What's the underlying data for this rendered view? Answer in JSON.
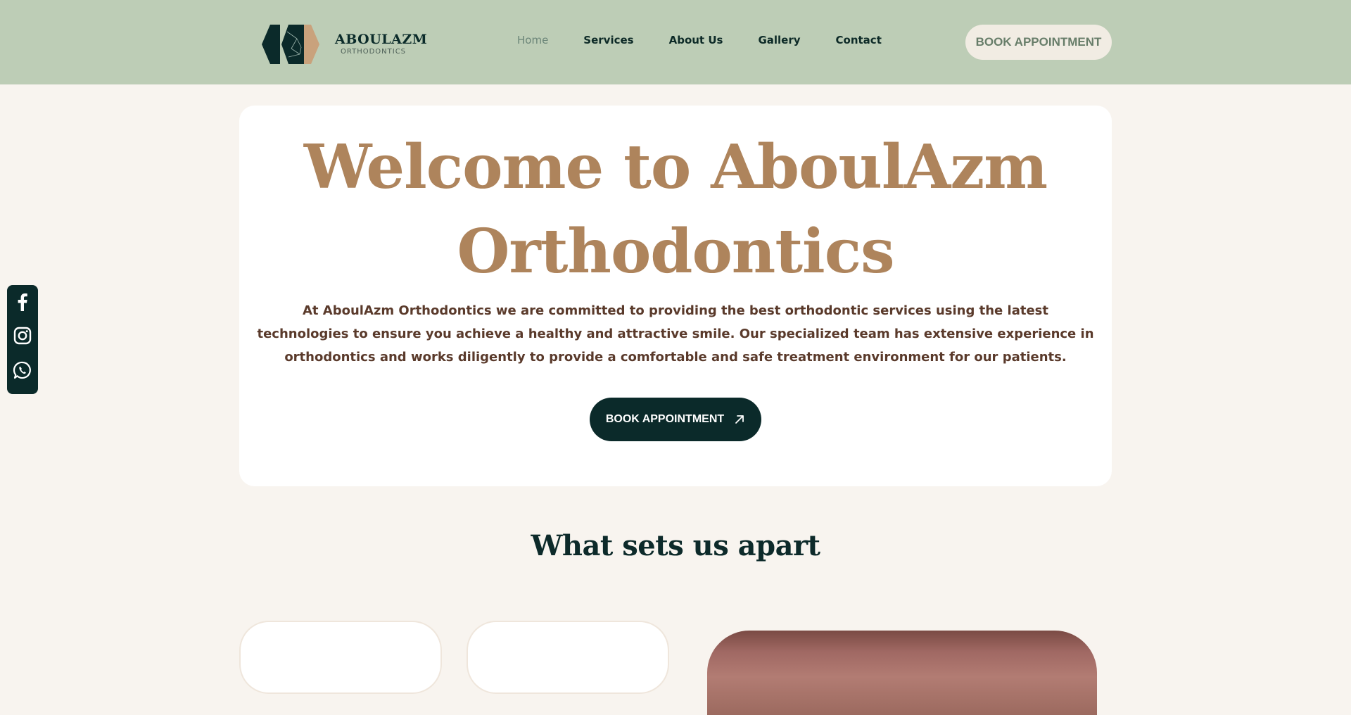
{
  "brand": {
    "name": "ABOULAZM",
    "tagline": "ORTHODONTICS",
    "colors": {
      "primary": "#0b2a2a",
      "accent": "#ae845c",
      "header_bg": "#bdcdb6",
      "page_bg": "#f8f4ef"
    }
  },
  "nav": {
    "items": [
      {
        "label": "Home",
        "active": true
      },
      {
        "label": "Services",
        "active": false
      },
      {
        "label": "About Us",
        "active": false
      },
      {
        "label": "Gallery",
        "active": false
      },
      {
        "label": "Contact",
        "active": false
      }
    ],
    "cta_label": "BOOK APPOINTMENT"
  },
  "hero": {
    "title": "Welcome to AboulAzm Orthodontics",
    "description": "At AboulAzm Orthodontics we are committed to providing the best orthodontic services using the latest technologies to ensure you achieve a healthy and attractive smile. Our specialized team has extensive experience in orthodontics and works diligently to provide a comfortable and safe treatment environment for our patients.",
    "cta_label": "BOOK APPOINTMENT",
    "cta_icon": "arrow-up-right-icon"
  },
  "social": {
    "icons": [
      "facebook-icon",
      "instagram-icon",
      "whatsapp-icon"
    ]
  },
  "features": {
    "title": "What sets us apart"
  }
}
